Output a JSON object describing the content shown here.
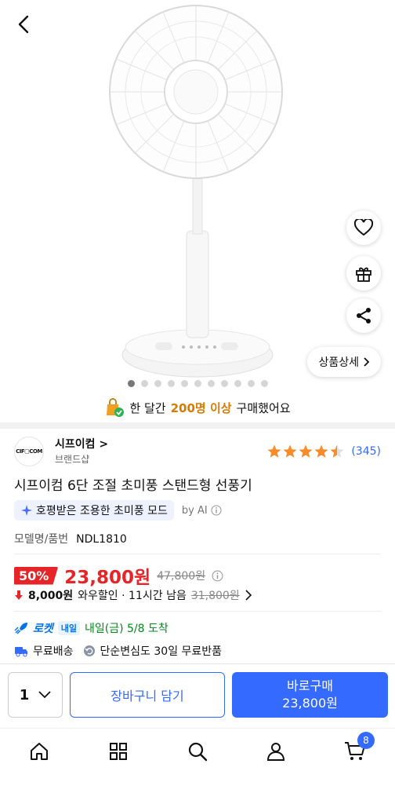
{
  "hero": {
    "detail_label": "상품상세",
    "image_count": 11,
    "active_index": 0
  },
  "purchase_banner": {
    "prefix": "한 달간",
    "count": "200명 이상",
    "suffix": "구매했어요"
  },
  "seller": {
    "logo_text": "CIF▢COM",
    "name": "시프이컴 >",
    "type": "브랜드샵",
    "rating": 4.5,
    "review_count": "(345)"
  },
  "product": {
    "title": "시프이컴 6단 조절 초미풍 스탠드형 선풍기",
    "ai_tag": "호평받은 조용한 초미풍 모드",
    "ai_by": "by AI",
    "model_label": "모델명/품번",
    "model_value": "NDL1810"
  },
  "price": {
    "discount": "50%",
    "sale": "23,800원",
    "original": "47,800원",
    "wow_amount": "8,000원",
    "wow_label": "와우할인 · 11시간 남음",
    "wow_strike": "31,800원"
  },
  "delivery": {
    "rocket_label": "로켓",
    "rocket_badge": "내일",
    "arrival": "내일(금) 5/8 도착",
    "free_shipping": "무료배송",
    "return_policy": "단순변심도 30일 무료반품"
  },
  "cta": {
    "quantity": "1",
    "cart_label": "장바구니 담기",
    "buy_label": "바로구매",
    "buy_price": "23,800원"
  },
  "nav": {
    "cart_badge": "8"
  },
  "colors": {
    "accent": "#346aff",
    "price_red": "#e52528",
    "star": "#f78c2a",
    "rocket_green": "#00891a"
  }
}
